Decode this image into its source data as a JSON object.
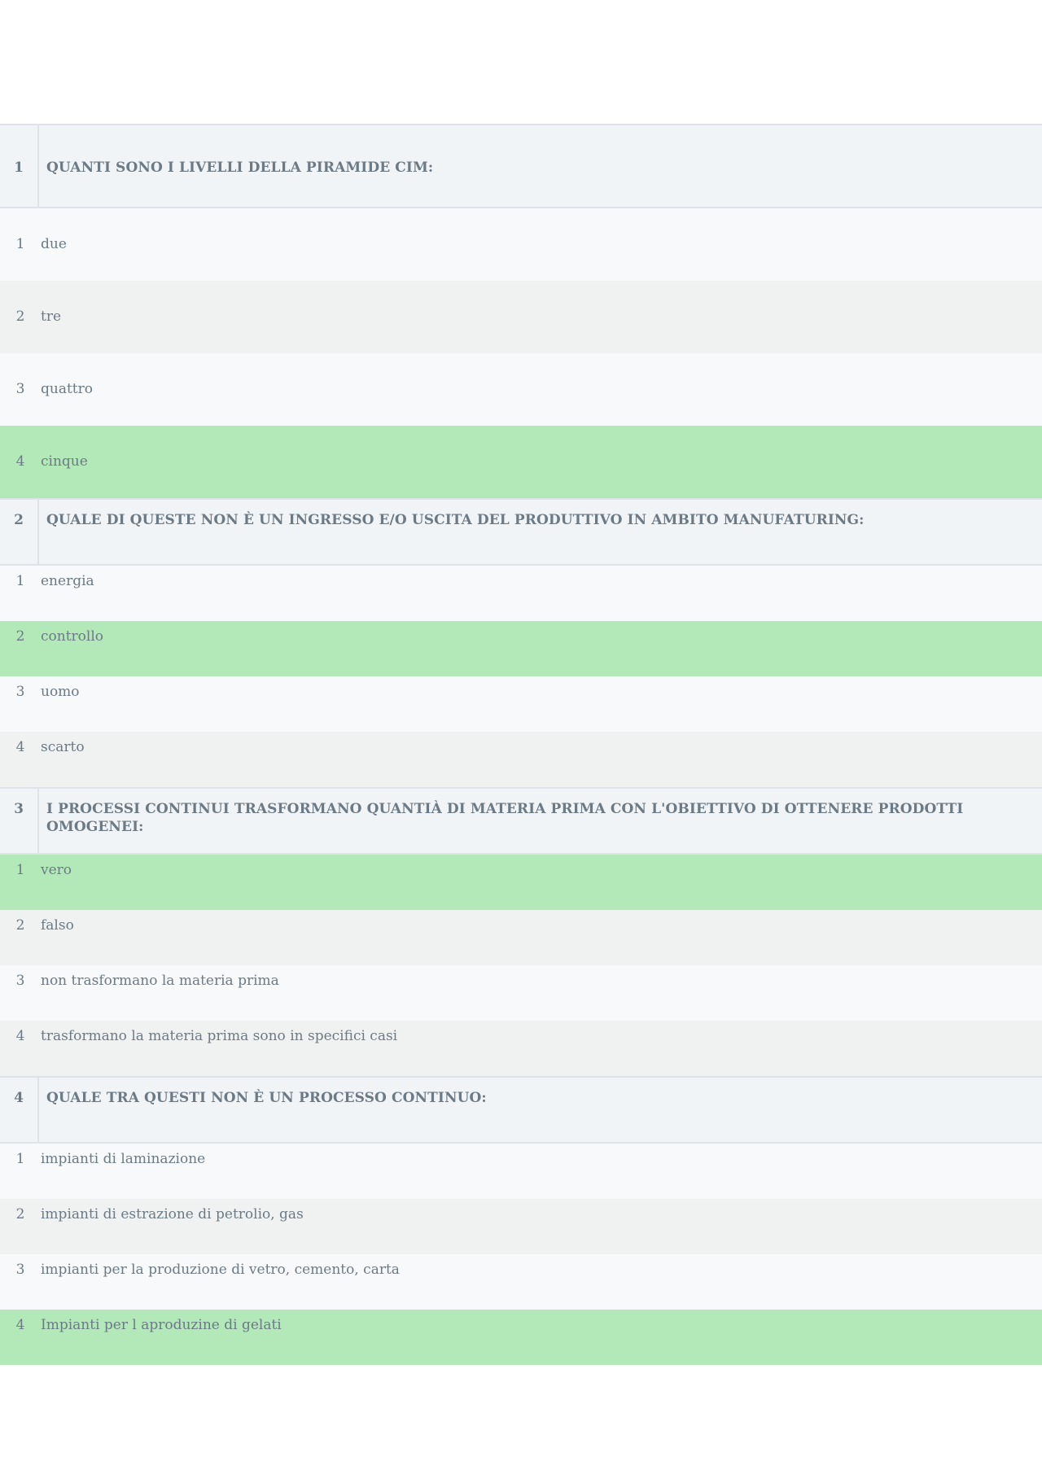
{
  "colors": {
    "question_bg": "#f1f4f7",
    "answer_bg_light": "#f8f9fb",
    "answer_bg_grey": "#f0f2f2",
    "correct_bg": "#b3e9b9",
    "text": "#6b7a85"
  },
  "questions": [
    {
      "number": "1",
      "text": "QUANTI SONO I LIVELLI DELLA PIRAMIDE CIM:",
      "answers": [
        {
          "number": "1",
          "text": "due",
          "correct": false
        },
        {
          "number": "2",
          "text": "tre",
          "correct": false
        },
        {
          "number": "3",
          "text": "quattro",
          "correct": false
        },
        {
          "number": "4",
          "text": "cinque",
          "correct": true
        }
      ]
    },
    {
      "number": "2",
      "text": "QUALE DI QUESTE NON È UN INGRESSO E/O USCITA DEL PRODUTTIVO IN AMBITO MANUFATURING:",
      "answers": [
        {
          "number": "1",
          "text": "energia",
          "correct": false
        },
        {
          "number": "2",
          "text": "controllo",
          "correct": true
        },
        {
          "number": "3",
          "text": "uomo",
          "correct": false
        },
        {
          "number": "4",
          "text": "scarto",
          "correct": false
        }
      ]
    },
    {
      "number": "3",
      "text": "I PROCESSI CONTINUI TRASFORMANO QUANTIÀ DI MATERIA PRIMA CON L'OBIETTIVO DI OTTENERE PRODOTTI OMOGENEI:",
      "answers": [
        {
          "number": "1",
          "text": "vero",
          "correct": true
        },
        {
          "number": "2",
          "text": "falso",
          "correct": false
        },
        {
          "number": "3",
          "text": "non trasformano la materia prima",
          "correct": false
        },
        {
          "number": "4",
          "text": "trasformano la materia prima sono in specifici casi",
          "correct": false
        }
      ]
    },
    {
      "number": "4",
      "text": "QUALE TRA QUESTI NON È UN PROCESSO CONTINUO:",
      "answers": [
        {
          "number": "1",
          "text": "impianti di laminazione",
          "correct": false
        },
        {
          "number": "2",
          "text": "impianti di estrazione di petrolio, gas",
          "correct": false
        },
        {
          "number": "3",
          "text": "impianti per la produzione di vetro, cemento, carta",
          "correct": false
        },
        {
          "number": "4",
          "text": "Impianti per l aproduzine di gelati",
          "correct": true
        }
      ]
    }
  ]
}
